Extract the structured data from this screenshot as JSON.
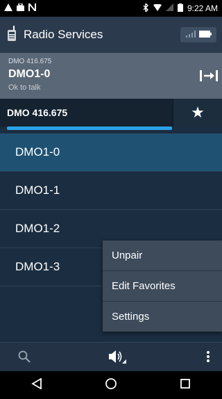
{
  "status_bar": {
    "time": "9:22 AM"
  },
  "app_bar": {
    "title": "Radio Services",
    "icon": "walkie-talkie-icon",
    "signal": "signal-battery-indicator"
  },
  "info": {
    "channel": "DMO 416.675",
    "talkgroup": "DMO1-0",
    "status": "Ok to talk"
  },
  "channel_bar": {
    "name": "DMO 416.675",
    "favorite_icon": "star-icon",
    "progress": 0.74
  },
  "list": [
    "DMO1-0",
    "DMO1-1",
    "DMO1-2",
    "DMO1-3"
  ],
  "menu": [
    "Unpair",
    "Edit Favorites",
    "Settings"
  ],
  "bottom_bar": [
    "search-icon",
    "speaker-volume-icon",
    "overflow-menu-icon"
  ],
  "nav_bar": [
    "back-icon",
    "home-icon",
    "recents-icon"
  ]
}
